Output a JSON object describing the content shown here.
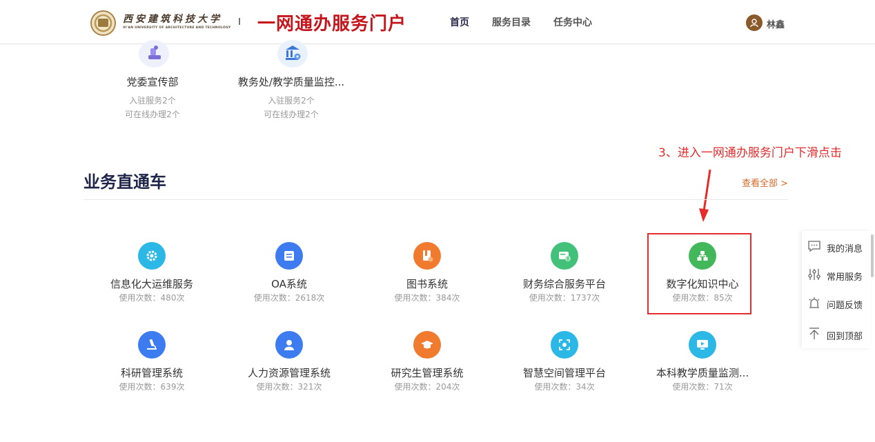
{
  "header": {
    "logo_cn": "西安建筑科技大学",
    "logo_en": "XI'AN UNIVERSITY OF ARCHITECTURE AND TECHNOLOGY",
    "portal_title": "一网通办服务门户",
    "nav": [
      "首页",
      "服务目录",
      "任务中心"
    ],
    "user_name": "林鑫"
  },
  "departments": [
    {
      "name": "党委宣传部",
      "services": "入驻服务2个",
      "online": "可在线办理2个"
    },
    {
      "name": "教务处/教学质量监控...",
      "services": "入驻服务2个",
      "online": "可在线办理2个"
    }
  ],
  "section": {
    "title": "业务直通车",
    "view_all": "查看全部 >"
  },
  "annotation": {
    "text": "3、进入一网通办服务门户下滑点击"
  },
  "services": [
    {
      "name": "信息化大运维服务",
      "count": "使用次数：480次",
      "color": "#2bb8e6",
      "icon": "gear-icon"
    },
    {
      "name": "OA系统",
      "count": "使用次数：2618次",
      "color": "#3c7bf0",
      "icon": "document-icon"
    },
    {
      "name": "图书系统",
      "count": "使用次数：384次",
      "color": "#f07a2e",
      "icon": "book-icon"
    },
    {
      "name": "财务综合服务平台",
      "count": "使用次数：1737次",
      "color": "#43c17a",
      "icon": "finance-icon"
    },
    {
      "name": "数字化知识中心",
      "count": "使用次数：85次",
      "color": "#43b85a",
      "icon": "hierarchy-icon"
    },
    {
      "name": "科研管理系统",
      "count": "使用次数：639次",
      "color": "#3c7bf0",
      "icon": "microscope-icon"
    },
    {
      "name": "人力资源管理系统",
      "count": "使用次数：321次",
      "color": "#3c7bf0",
      "icon": "person-icon"
    },
    {
      "name": "研究生管理系统",
      "count": "使用次数：204次",
      "color": "#f07a2e",
      "icon": "graduation-cap-icon"
    },
    {
      "name": "智慧空间管理平台",
      "count": "使用次数：34次",
      "color": "#2bb8e6",
      "icon": "space-icon"
    },
    {
      "name": "本科教学质量监测...",
      "count": "使用次数：71次",
      "color": "#2bb8e6",
      "icon": "monitor-icon"
    }
  ],
  "float_bar": [
    "我的消息",
    "常用服务",
    "问题反馈",
    "回到顶部"
  ]
}
